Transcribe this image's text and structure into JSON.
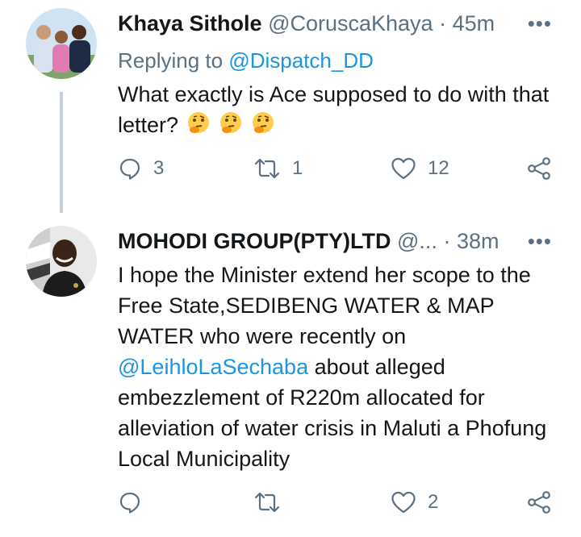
{
  "colors": {
    "link": "#1b95e0",
    "secondary": "#5b7083",
    "thread_line": "#c7d0d8"
  },
  "tweets": [
    {
      "name": "Khaya Sithole",
      "handle": "@CoruscaKhaya",
      "dot": "·",
      "time": "45m",
      "more": "•••",
      "reply_prefix": "Replying to",
      "reply_handle": "@Dispatch_DD",
      "body": "What exactly is Ace supposed to do with that letter?",
      "emoji": [
        "thinking-face",
        "thinking-face",
        "thinking-face"
      ],
      "reply_count": "3",
      "retweet_count": "1",
      "like_count": "12"
    },
    {
      "name": "MOHODI GROUP(PTY)LTD",
      "handle": "@...",
      "dot": "·",
      "time": "38m",
      "more": "•••",
      "body_before": "I hope the Minister extend her scope to the Free State,SEDIBENG WATER & MAP WATER who were recently on ",
      "mention": "@LeihloLaSechaba",
      "body_after": " about alleged embezzlement of R220m allocated for alleviation of water crisis in Maluti a Phofung Local Municipality",
      "like_count": "2"
    }
  ]
}
